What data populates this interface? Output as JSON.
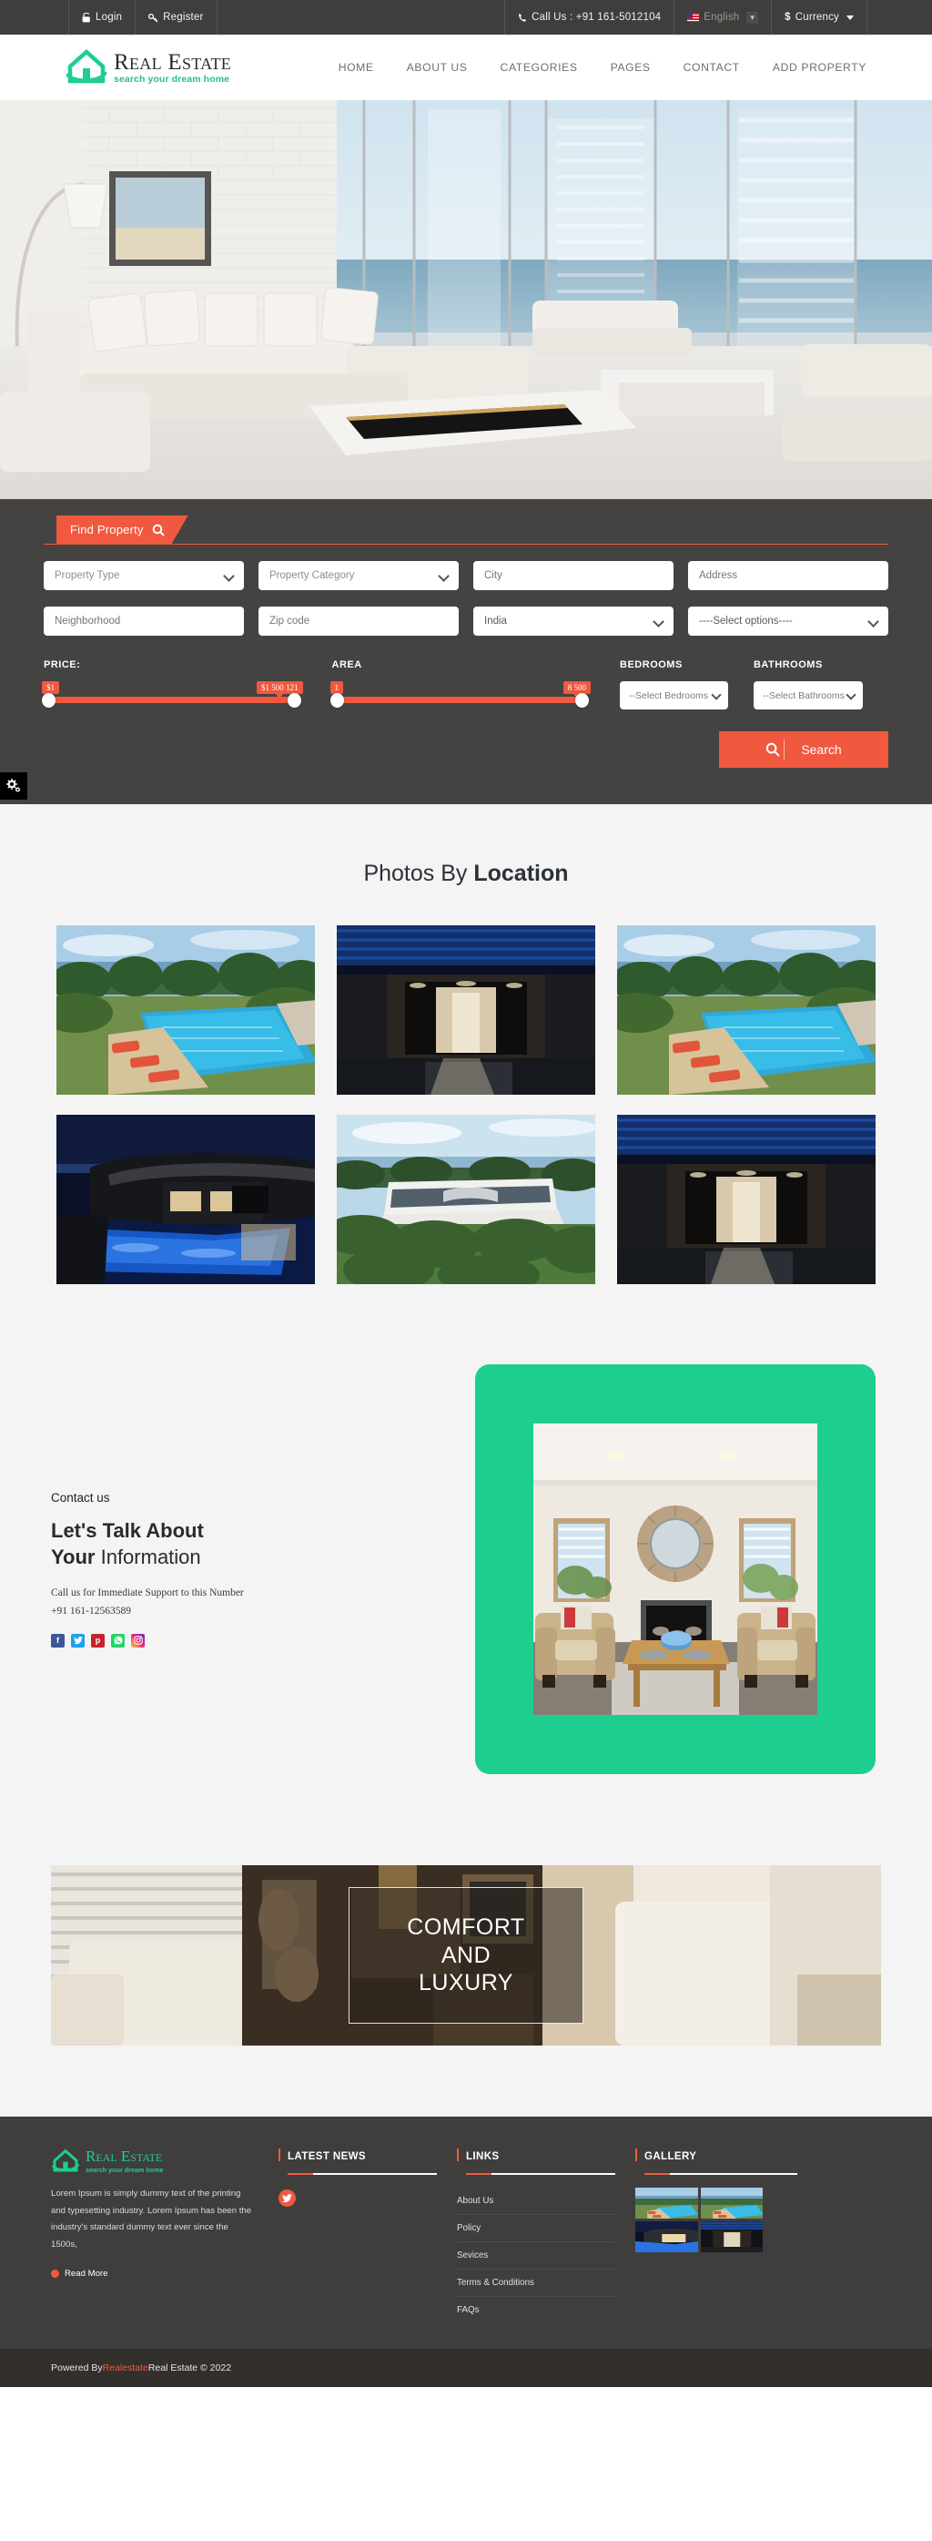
{
  "topbar": {
    "login": "Login",
    "register": "Register",
    "call_us": "Call Us : +91 161-5012104",
    "language": "English",
    "currency": "Currency",
    "currency_symbol": "$"
  },
  "header": {
    "logo_title": "Real Estate",
    "logo_tagline": "search your dream home",
    "nav": [
      {
        "label": "HOME"
      },
      {
        "label": "ABOUT US"
      },
      {
        "label": "CATEGORIES"
      },
      {
        "label": "PAGES"
      },
      {
        "label": "CONTACT"
      },
      {
        "label": "ADD PROPERTY"
      }
    ]
  },
  "search": {
    "tab_label": "Find Property",
    "property_type": "Property Type",
    "property_category": "Property Category",
    "city_placeholder": "City",
    "address_placeholder": "Address",
    "neighborhood_placeholder": "Neighborhood",
    "zip_placeholder": "Zip code",
    "country": "India",
    "options": "----Select options----",
    "price_label": "PRICE:",
    "price_min": "$1",
    "price_max": "$1 500 121",
    "area_label": "AREA",
    "area_min": "1",
    "area_max": "8 500",
    "bedrooms_label": "BEDROOMS",
    "bedrooms_value": "--Select Bedrooms",
    "bathrooms_label": "BATHROOMS",
    "bathrooms_value": "--Select Bathrooms",
    "search_button": "Search"
  },
  "photos": {
    "title_light": "Photos By ",
    "title_bold": "Location",
    "items": [
      {
        "name": "villa-pool-daylight"
      },
      {
        "name": "modern-entrance-night"
      },
      {
        "name": "villa-pool-daylight"
      },
      {
        "name": "hillside-house-night"
      },
      {
        "name": "white-modern-villa"
      },
      {
        "name": "modern-entrance-night"
      }
    ]
  },
  "contact": {
    "eyebrow": "Contact us",
    "heading_bold_1": "Let's Talk About",
    "heading_bold_2": "Your",
    "heading_light_2": " Information",
    "note_line1": "Call us for Immediate Support to this Number",
    "note_line2": "+91 161-12563589",
    "socials": [
      {
        "name": "facebook",
        "glyph": "f",
        "color": "#3b5998"
      },
      {
        "name": "twitter",
        "glyph": "t",
        "color": "#1da1f2"
      },
      {
        "name": "pinterest",
        "glyph": "p",
        "color": "#c8232c"
      },
      {
        "name": "whatsapp",
        "glyph": "w",
        "color": "#25d366"
      },
      {
        "name": "instagram",
        "glyph": "i",
        "color": "#e1306c"
      }
    ],
    "card_image": "living-room-fireplace"
  },
  "banner": {
    "line1": "COMFORT",
    "line2": "AND",
    "line3": "LUXURY"
  },
  "footer": {
    "logo_title": "Real Estate",
    "logo_tagline": "search your dream home",
    "about_text": "Lorem Ipsum is simply dummy text of the printing and typesetting industry. Lorem Ipsum has been the industry's standard dummy text ever since the 1500s,",
    "read_more": "Read More",
    "latest_news_title": "LATEST NEWS",
    "links_title": "LINKS",
    "links": [
      {
        "label": "About Us"
      },
      {
        "label": "Policy"
      },
      {
        "label": "Sevices"
      },
      {
        "label": "Terms & Conditions"
      },
      {
        "label": "FAQs"
      }
    ],
    "gallery_title": "GALLERY",
    "gallery": [
      {
        "name": "villa-pool-daylight"
      },
      {
        "name": "villa-pool-daylight"
      },
      {
        "name": "hillside-house-night"
      },
      {
        "name": "modern-entrance-night"
      }
    ],
    "copyright_prefix": "Powered By ",
    "copyright_brand": "Realestate",
    "copyright_suffix": " Real Estate © 2022"
  },
  "colors": {
    "accent": "#f0593f",
    "green": "#1ece8f",
    "dark": "#3f3e3c"
  }
}
